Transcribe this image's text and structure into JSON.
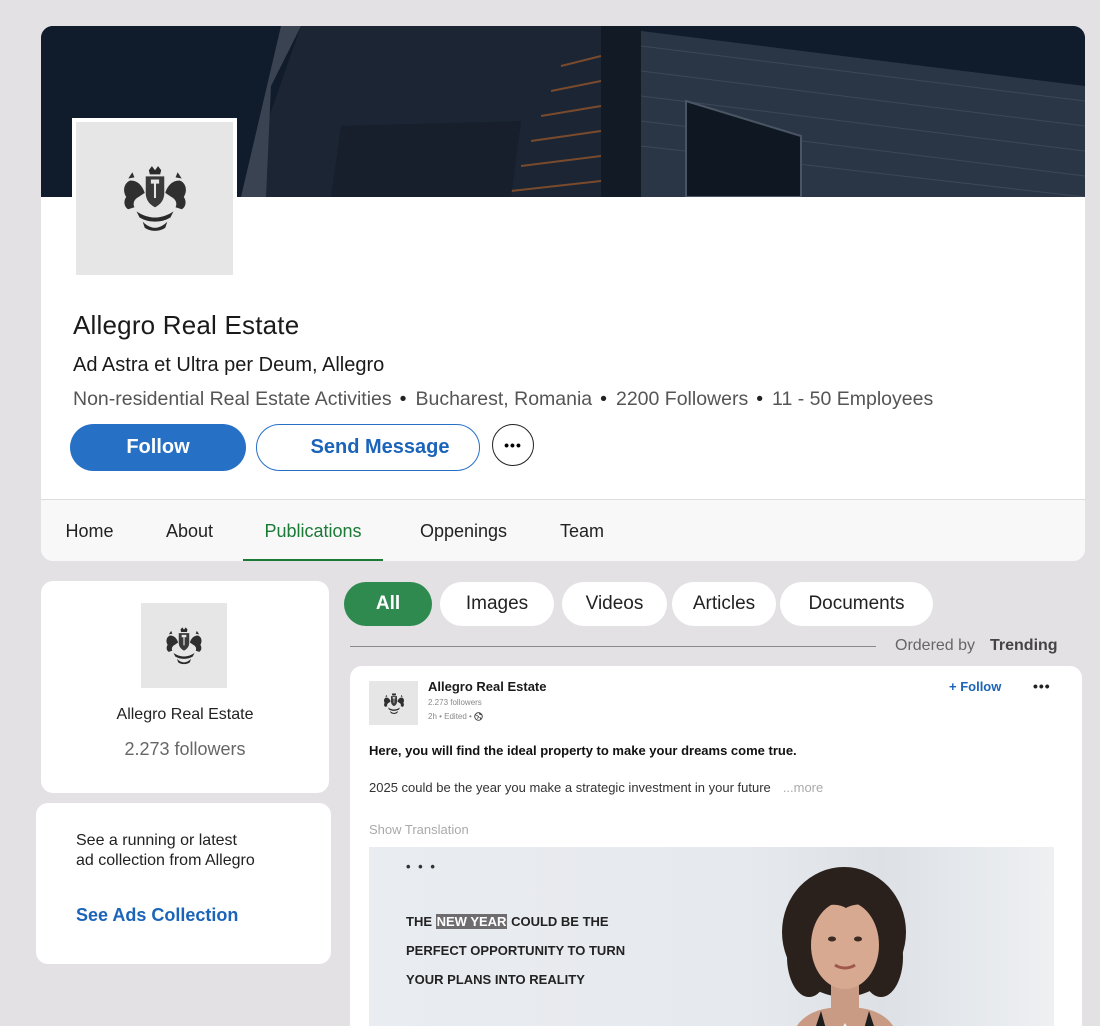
{
  "company": {
    "name": "Allegro Real Estate",
    "tagline": "Ad Astra et Ultra per Deum, Allegro",
    "meta": [
      "Non-residential Real Estate Activities",
      "Bucharest, Romania",
      "2200 Followers",
      "11 - 50 Employees"
    ],
    "meta_separator": "•"
  },
  "actions": {
    "follow_label": "Follow",
    "message_label": "Send Message",
    "more_label": "•••"
  },
  "tabs": [
    {
      "label": "Home",
      "active": false
    },
    {
      "label": "About",
      "active": false
    },
    {
      "label": "Publications",
      "active": true
    },
    {
      "label": "Oppenings",
      "active": false
    },
    {
      "label": "Team",
      "active": false
    }
  ],
  "sidebar": {
    "name": "Allegro Real Estate",
    "followers": "2.273 followers",
    "ads_text": "See a running or latest ad collection from Allegro",
    "ads_link": "See Ads Collection"
  },
  "filters": {
    "chips": [
      {
        "label": "All",
        "active": true
      },
      {
        "label": "Images",
        "active": false
      },
      {
        "label": "Videos",
        "active": false
      },
      {
        "label": "Articles",
        "active": false
      },
      {
        "label": "Documents",
        "active": false
      }
    ],
    "order_label": "Ordered by",
    "order_value": "Trending"
  },
  "post": {
    "author": "Allegro Real Estate",
    "followers": "2.273 followers",
    "time": "2h • Edited •",
    "follow_label": "+ Follow",
    "more_label": "•••",
    "headline": "Here, you will find the ideal property to make your dreams come true.",
    "body": "2025 could be the year you make a strategic investment in your future",
    "more_link": "...more",
    "translate": "Show Translation",
    "image": {
      "dots": "• • •",
      "line1_pre": "THE ",
      "line1_highlight": "NEW YEAR",
      "line1_post": " COULD BE THE",
      "line2": "PERFECT OPPORTUNITY TO TURN",
      "line3": "YOUR PLANS INTO REALITY"
    }
  },
  "colors": {
    "primary_blue": "#2670c6",
    "active_green": "#1c7a37",
    "chip_green": "#2e8a4f",
    "page_bg": "#e3e1e4"
  }
}
